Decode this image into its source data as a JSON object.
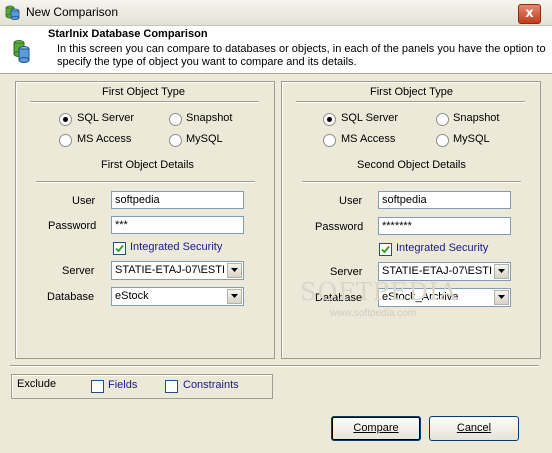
{
  "window": {
    "title": "New Comparison",
    "close_glyph": "x"
  },
  "header": {
    "title": "Starlnix Database Comparison",
    "description": "In this screen you can compare to databases or objects, in each of the panels you have the option to specify the type of object you want to compare and its details."
  },
  "panels": [
    {
      "type_heading": "First Object Type",
      "options": [
        "SQL Server",
        "Snapshot",
        "MS Access",
        "MySQL"
      ],
      "selected_option": "SQL Server",
      "details_heading": "First Object Details",
      "user_label": "User",
      "user_value": "softpedia",
      "password_label": "Password",
      "password_value": "***",
      "integrated_security_label": "Integrated Security",
      "integrated_security_checked": true,
      "server_label": "Server",
      "server_value": "STATIE-ETAJ-07\\ESTI",
      "database_label": "Database",
      "database_value": "eStock"
    },
    {
      "type_heading": "First Object Type",
      "options": [
        "SQL Server",
        "Snapshot",
        "MS Access",
        "MySQL"
      ],
      "selected_option": "SQL Server",
      "details_heading": "Second Object Details",
      "user_label": "User",
      "user_value": "softpedia",
      "password_label": "Password",
      "password_value": "*******",
      "integrated_security_label": "Integrated Security",
      "integrated_security_checked": true,
      "server_label": "Server",
      "server_value": "STATIE-ETAJ-07\\ESTI",
      "database_label": "Database",
      "database_value": "eStock_Archive"
    }
  ],
  "exclude": {
    "label": "Exclude",
    "fields_label": "Fields",
    "constraints_label": "Constraints",
    "fields_checked": false,
    "constraints_checked": false
  },
  "buttons": {
    "compare_label": "Compare",
    "cancel_label": "Cancel"
  },
  "watermark": {
    "text": "SOFTPEDIA",
    "url_text": "www.softpedia.com"
  },
  "colors": {
    "accent_link": "#1a1a8c",
    "window_bg": "#ece9d8",
    "close_red": "#c13b1c"
  }
}
